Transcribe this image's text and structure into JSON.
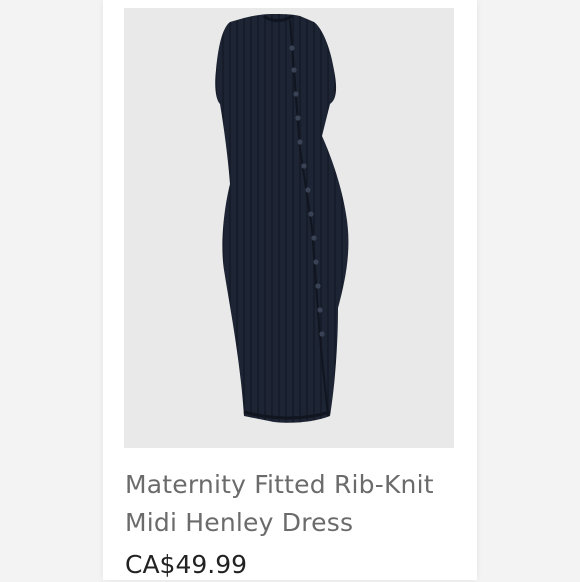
{
  "product": {
    "image_alt": "product-photo-navy-dress",
    "name": "Maternity Fitted Rib-Knit Midi Henley Dress",
    "price": "CA$49.99"
  },
  "colors": {
    "dress": "#1d2433",
    "image_background": "#e9e9e9",
    "name_text": "#6b6b6b",
    "price_text": "#222222"
  }
}
